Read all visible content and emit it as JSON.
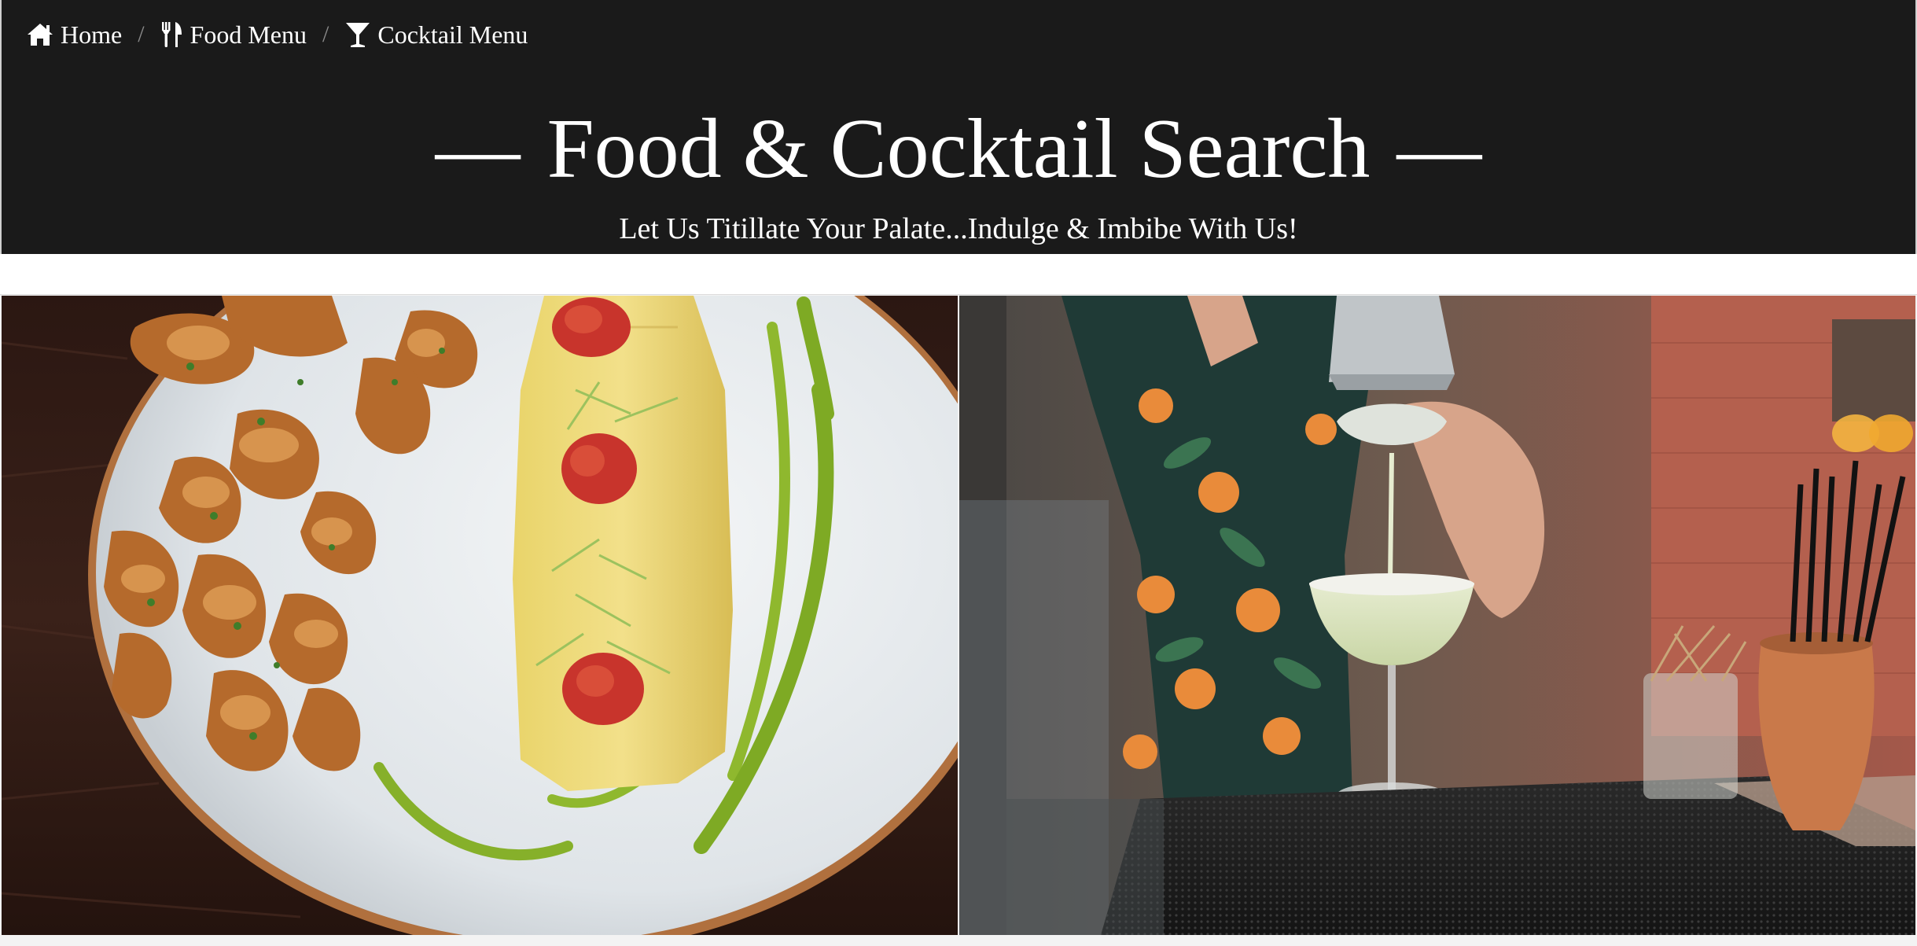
{
  "breadcrumb": {
    "items": [
      {
        "label": "Home",
        "icon": "home-icon"
      },
      {
        "label": "Food Menu",
        "icon": "fork-knife-icon"
      },
      {
        "label": "Cocktail Menu",
        "icon": "cocktail-glass-icon"
      }
    ],
    "separator": "/"
  },
  "header": {
    "dash": "—",
    "title": "Food & Cocktail Search",
    "subtitle": "Let Us Titillate Your Palate...Indulge & Imbibe With Us!",
    "background": "#1a1a1a",
    "text_color": "#ffffff"
  },
  "cards": [
    {
      "name": "food",
      "image": "omelette-and-potatoes-photo"
    },
    {
      "name": "cocktail",
      "image": "bartender-pouring-margarita-photo"
    }
  ]
}
